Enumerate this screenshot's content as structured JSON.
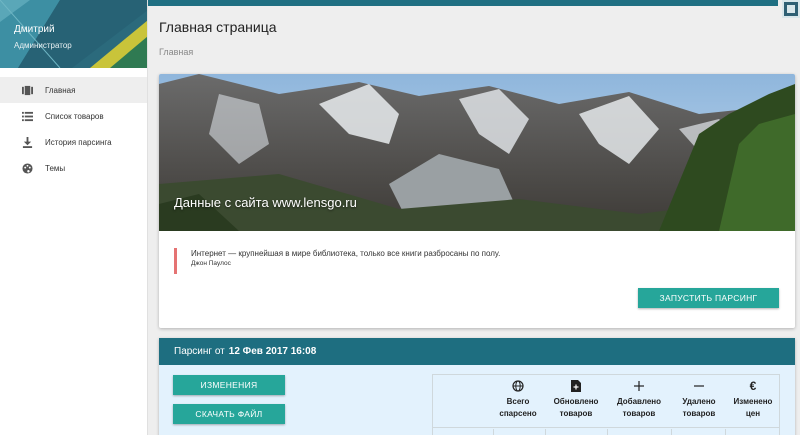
{
  "user": {
    "name": "Дмитрий",
    "role": "Администратор"
  },
  "sidebar": {
    "items": [
      {
        "label": "Главная",
        "icon": "dashboard-icon",
        "active": true
      },
      {
        "label": "Список товаров",
        "icon": "list-icon",
        "active": false
      },
      {
        "label": "История парсинга",
        "icon": "download-icon",
        "active": false
      },
      {
        "label": "Темы",
        "icon": "palette-icon",
        "active": false
      }
    ]
  },
  "header": {
    "title": "Главная страница",
    "breadcrumb": "Главная"
  },
  "hero": {
    "caption": "Данные с сайта www.lensgo.ru",
    "quote": "Интернет — крупнейшая в мире библиотека, только все книги разбросаны по полу.",
    "author": "Джон Паулос",
    "button": "Запустить парсинг"
  },
  "parsing": {
    "header_prefix": "Парсинг от",
    "datetime": "12 Фев 2017 16:08",
    "changes_button": "Изменения",
    "download_button": "Скачать файл",
    "stats": [
      {
        "icon": "globe-icon",
        "label_line1": "Всего",
        "label_line2": "спарсено"
      },
      {
        "icon": "file-add-icon",
        "label_line1": "Обновлено",
        "label_line2": "товаров"
      },
      {
        "icon": "plus-icon",
        "label_line1": "Добавлено",
        "label_line2": "товаров"
      },
      {
        "icon": "minus-icon",
        "label_line1": "Удалено",
        "label_line2": "товаров"
      },
      {
        "icon": "euro-icon",
        "label_line1": "Изменено",
        "label_line2": "цен"
      }
    ]
  },
  "colors": {
    "accent": "#26a69a",
    "header": "#1e6e80",
    "quote_border": "#e57373"
  }
}
